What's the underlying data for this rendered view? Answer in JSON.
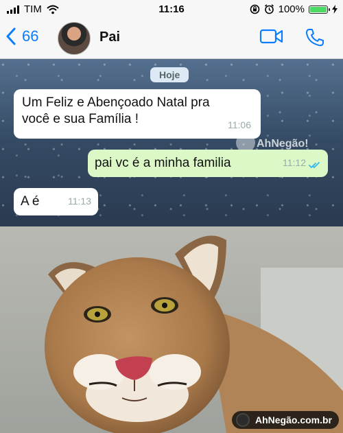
{
  "status": {
    "carrier": "TIM",
    "time": "11:16",
    "battery_pct": "100%",
    "battery_level": 1.0
  },
  "header": {
    "back_count": "66",
    "contact_name": "Pai"
  },
  "chat": {
    "day_label": "Hoje",
    "messages": [
      {
        "direction": "in",
        "line1": "Um Feliz e Abençoado Natal pra",
        "line2": "você e sua Família !",
        "time": "11:06"
      },
      {
        "direction": "out",
        "text": "pai vc é a minha familia",
        "time": "11:12",
        "status": "read"
      },
      {
        "direction": "in",
        "text": "A é",
        "time": "11:13"
      }
    ],
    "watermark": {
      "brand_ah": "Ah",
      "brand_name": "Negão!",
      "brand_domain": ".com.br"
    }
  },
  "photo": {
    "subject": "cougar",
    "watermark": "AhNegão.com.br"
  },
  "colors": {
    "ios_blue": "#0a7cff",
    "outgoing_bubble": "#dcf8c6",
    "incoming_bubble": "#ffffff",
    "read_ticks": "#34b7f1",
    "battery": "#4cd964"
  }
}
